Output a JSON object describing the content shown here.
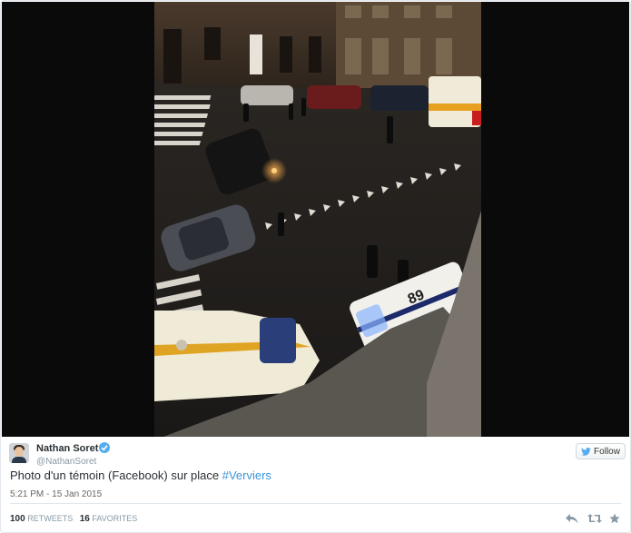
{
  "tweet": {
    "author_name": "Nathan Soret",
    "author_handle": "@NathanSoret",
    "follow_label": "Follow",
    "text_plain": "Photo d'un témoin (Facebook) sur place ",
    "hashtag": "#Verviers",
    "timestamp": "5:21 PM - 15 Jan 2015",
    "retweets_count": "100",
    "retweets_label": "RETWEETS",
    "favorites_count": "16",
    "favorites_label": "FAVORITES"
  },
  "photo": {
    "van_number": "89"
  },
  "icons": {
    "verified": "verified-badge-icon",
    "follow": "twitter-bird-icon",
    "reply": "reply-icon",
    "retweet": "retweet-icon",
    "favorite": "star-icon"
  },
  "colors": {
    "link": "#3b94d9",
    "verified": "#55acee",
    "muted": "#8899a6",
    "text": "#292f33"
  }
}
